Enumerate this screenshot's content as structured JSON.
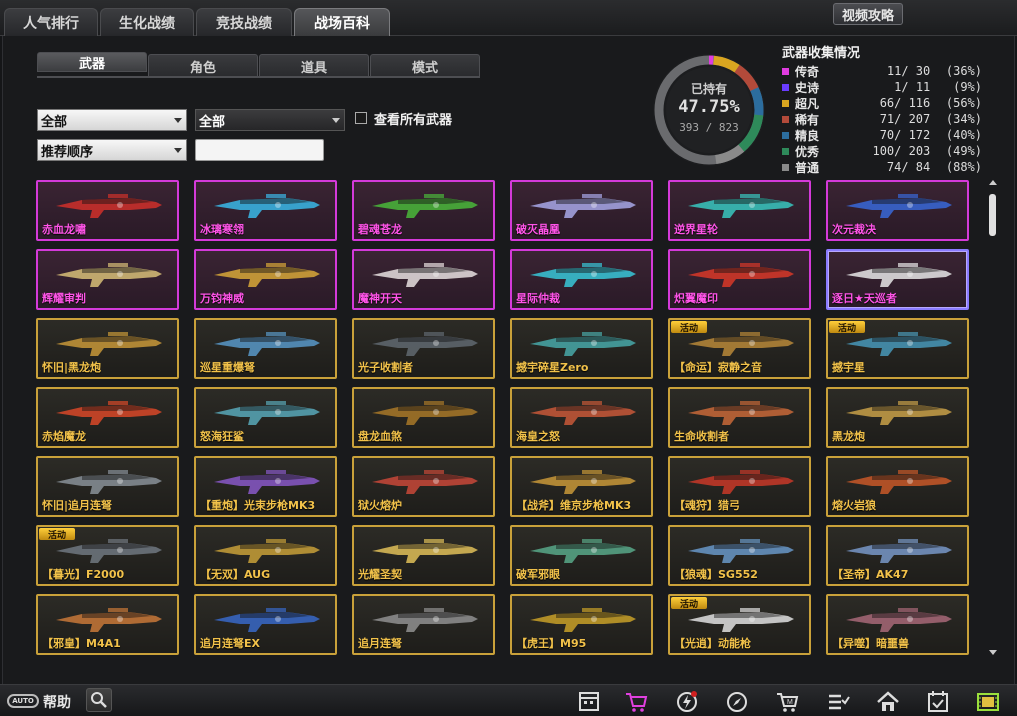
{
  "top_tabs": [
    "人气排行",
    "生化战绩",
    "竞技战绩",
    "战场百科"
  ],
  "video_button": "视频攻略",
  "sub_tabs": [
    "武器",
    "角色",
    "道具",
    "模式"
  ],
  "filters": {
    "category": "全部",
    "subcategory": "全部",
    "sort": "推荐顺序",
    "search_value": "",
    "show_all_label": "查看所有武器"
  },
  "collection": {
    "title": "武器收集情况",
    "owned_label": "已持有",
    "percent": "47.75%",
    "count": "393 / 823",
    "owned_fraction": 0.4775,
    "rarities": [
      {
        "name": "传奇",
        "count": "11/  30",
        "pct": "(36%)",
        "color": "#e03ce0"
      },
      {
        "name": "史诗",
        "count": "1/  11",
        "pct": "(9%)",
        "color": "#6a3cff"
      },
      {
        "name": "超凡",
        "count": "66/ 116",
        "pct": "(56%)",
        "color": "#d9a520"
      },
      {
        "name": "稀有",
        "count": "71/ 207",
        "pct": "(34%)",
        "color": "#b24a3a"
      },
      {
        "name": "精良",
        "count": "70/ 172",
        "pct": "(40%)",
        "color": "#2c6d9e"
      },
      {
        "name": "优秀",
        "count": "100/ 203",
        "pct": "(49%)",
        "color": "#2e8a5a"
      },
      {
        "name": "普通",
        "count": "74/  84",
        "pct": "(88%)",
        "color": "#8a8a8a"
      }
    ]
  },
  "weapons": [
    {
      "name": "赤血龙嘯",
      "rarity": "legend",
      "color": "#d0302a",
      "badge": ""
    },
    {
      "name": "冰璃寒翎",
      "rarity": "legend",
      "color": "#3ab8e8",
      "badge": ""
    },
    {
      "name": "碧魂苍龙",
      "rarity": "legend",
      "color": "#4ab83a",
      "badge": ""
    },
    {
      "name": "破灭晶凰",
      "rarity": "legend",
      "color": "#a8a8e8",
      "badge": ""
    },
    {
      "name": "逆界星轮",
      "rarity": "legend",
      "color": "#38c8c0",
      "badge": ""
    },
    {
      "name": "次元裁决",
      "rarity": "legend",
      "color": "#3868d8",
      "badge": ""
    },
    {
      "name": "辉耀审判",
      "rarity": "legend",
      "color": "#d8c078",
      "badge": ""
    },
    {
      "name": "万钧神威",
      "rarity": "legend",
      "color": "#d8a838",
      "badge": ""
    },
    {
      "name": "魔神开天",
      "rarity": "legend",
      "color": "#e8e0e0",
      "badge": ""
    },
    {
      "name": "星际仲裁",
      "rarity": "legend",
      "color": "#38c8d8",
      "badge": ""
    },
    {
      "name": "炽翼魔印",
      "rarity": "legend",
      "color": "#d83828",
      "badge": ""
    },
    {
      "name": "逐日★天巡者",
      "rarity": "selected",
      "color": "#e8e8e8",
      "badge": ""
    },
    {
      "name": "怀旧|黑龙炮",
      "rarity": "gold",
      "color": "#c89838",
      "badge": ""
    },
    {
      "name": "巡星重爆弩",
      "rarity": "gold",
      "color": "#5898c8",
      "badge": ""
    },
    {
      "name": "光子收割者",
      "rarity": "gold",
      "color": "#606870",
      "badge": ""
    },
    {
      "name": "撼宇碎星Zero",
      "rarity": "gold",
      "color": "#48a8a8",
      "badge": ""
    },
    {
      "name": "【命运】寂静之音",
      "rarity": "gold",
      "color": "#b88838",
      "badge": "活动"
    },
    {
      "name": "撼宇星",
      "rarity": "gold",
      "color": "#4898b8",
      "badge": "活动"
    },
    {
      "name": "赤焰魔龙",
      "rarity": "gold",
      "color": "#d84828",
      "badge": ""
    },
    {
      "name": "怒海狂鲨",
      "rarity": "gold",
      "color": "#58a8b8",
      "badge": ""
    },
    {
      "name": "盘龙血煞",
      "rarity": "gold",
      "color": "#a87828",
      "badge": ""
    },
    {
      "name": "海皇之怒",
      "rarity": "gold",
      "color": "#c85838",
      "badge": ""
    },
    {
      "name": "生命收割者",
      "rarity": "gold",
      "color": "#c86838",
      "badge": ""
    },
    {
      "name": "黑龙炮",
      "rarity": "gold",
      "color": "#c8a048",
      "badge": ""
    },
    {
      "name": "怀旧|追月连弩",
      "rarity": "gold",
      "color": "#889098",
      "badge": ""
    },
    {
      "name": "【重炮】光束步枪MK3",
      "rarity": "gold",
      "color": "#8858c8",
      "badge": ""
    },
    {
      "name": "狱火熔炉",
      "rarity": "gold",
      "color": "#c84838",
      "badge": ""
    },
    {
      "name": "【战斧】维京步枪MK3",
      "rarity": "gold",
      "color": "#c89838",
      "badge": ""
    },
    {
      "name": "【魂狩】猎弓",
      "rarity": "gold",
      "color": "#c83828",
      "badge": ""
    },
    {
      "name": "熔火岩狼",
      "rarity": "gold",
      "color": "#c85828",
      "badge": ""
    },
    {
      "name": "【暮光】F2000",
      "rarity": "gold",
      "color": "#707880",
      "badge": "活动"
    },
    {
      "name": "【无双】AUG",
      "rarity": "gold",
      "color": "#c8a038",
      "badge": ""
    },
    {
      "name": "光耀圣契",
      "rarity": "gold",
      "color": "#e0c058",
      "badge": ""
    },
    {
      "name": "破军邪眼",
      "rarity": "gold",
      "color": "#58a888",
      "badge": ""
    },
    {
      "name": "【狼魂】SG552",
      "rarity": "gold",
      "color": "#6898c8",
      "badge": ""
    },
    {
      "name": "【圣帝】AK47",
      "rarity": "gold",
      "color": "#7898c8",
      "badge": ""
    },
    {
      "name": "【邪皇】M4A1",
      "rarity": "gold",
      "color": "#c87838",
      "badge": ""
    },
    {
      "name": "追月连弩EX",
      "rarity": "gold",
      "color": "#3868c8",
      "badge": ""
    },
    {
      "name": "追月连弩",
      "rarity": "gold",
      "color": "#909090",
      "badge": ""
    },
    {
      "name": "【虎王】M95",
      "rarity": "gold",
      "color": "#c8a028",
      "badge": ""
    },
    {
      "name": "【光逍】动能枪",
      "rarity": "gold",
      "color": "#e0e0e0",
      "badge": "活动"
    },
    {
      "name": "【异噬】暗噩兽",
      "rarity": "gold",
      "color": "#a86878",
      "badge": ""
    }
  ],
  "bottom": {
    "help_badge": "AUTO",
    "help_label": "帮助",
    "dock_icons": [
      "calendar-icon",
      "shop-cart-icon",
      "lightning-icon",
      "compass-icon",
      "mall-cart-icon",
      "task-list-icon",
      "home-icon",
      "checkin-icon",
      "film-icon"
    ]
  }
}
